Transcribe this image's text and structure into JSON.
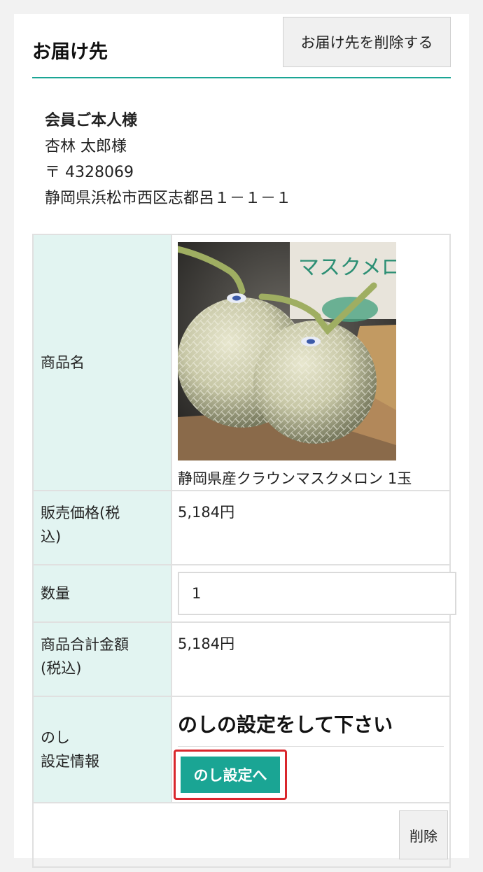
{
  "header": {
    "title": "お届け先",
    "delete_address_label": "お届け先を削除する"
  },
  "address": {
    "recipient_type": "会員ご本人様",
    "name": "杏林 太郎様",
    "postal": "〒 4328069",
    "street": "静岡県浜松市西区志都呂１－１－１"
  },
  "table": {
    "product_label": "商品名",
    "product_image_text": "マスクメロン",
    "product_name": "静岡県産クラウンマスクメロン 1玉",
    "price_label_1": "販売価格(税",
    "price_label_2": "込)",
    "price_value": "5,184円",
    "qty_label": "数量",
    "qty_value": "1",
    "total_label_1": "商品合計金額",
    "total_label_2": "(税込)",
    "total_value": "5,184円",
    "noshi_label_1": "のし",
    "noshi_label_2": "設定情報",
    "noshi_prompt": "のしの設定をして下さい",
    "noshi_button_label": "のし設定へ",
    "delete_label": "削除"
  },
  "colors": {
    "accent": "#1aa594",
    "label_bg": "#e2f4f1",
    "focus_ring": "#d9262c"
  }
}
